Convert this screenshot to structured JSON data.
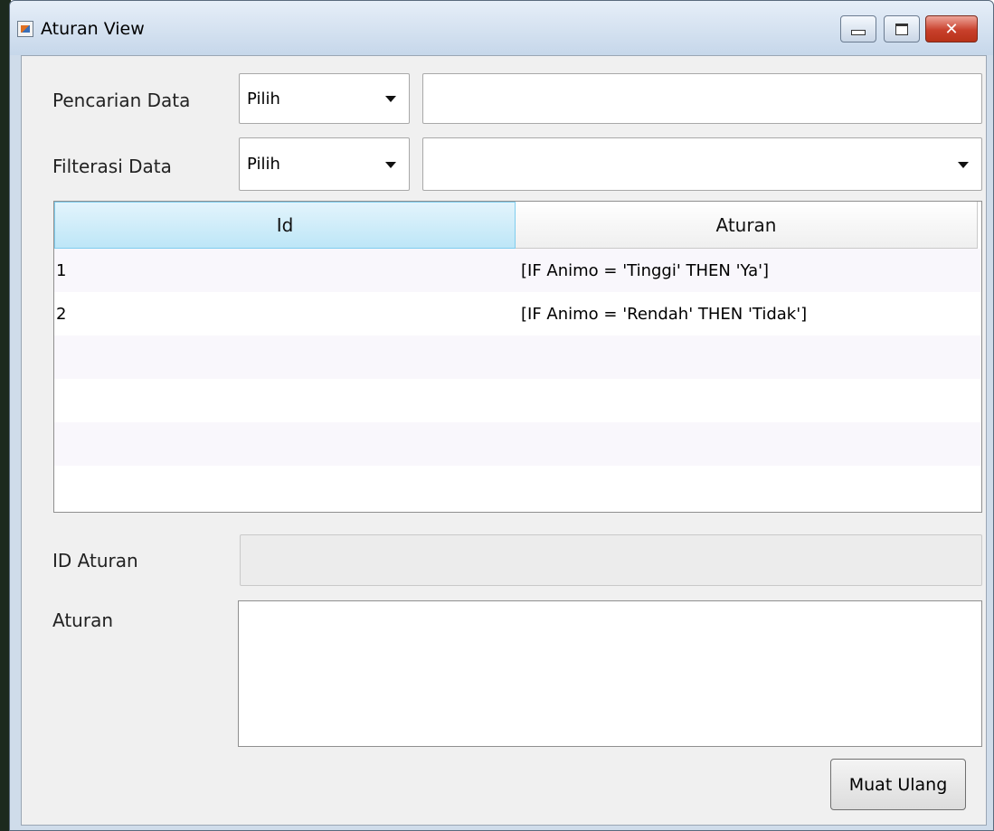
{
  "window": {
    "title": "Aturan View",
    "close_glyph": "✕"
  },
  "search": {
    "label": "Pencarian Data",
    "selected": "Pilih",
    "text_value": ""
  },
  "filter": {
    "label": "Filterasi Data",
    "selected": "Pilih",
    "value_selected": ""
  },
  "table": {
    "columns": [
      "Id",
      "Aturan"
    ],
    "rows": [
      {
        "id": "1",
        "aturan": "[IF Animo = 'Tinggi' THEN 'Ya']"
      },
      {
        "id": "2",
        "aturan": "[IF Animo = 'Rendah' THEN 'Tidak']"
      }
    ]
  },
  "form": {
    "id_label": "ID Aturan",
    "id_value": "",
    "aturan_label": "Aturan",
    "aturan_value": ""
  },
  "actions": {
    "reload_label": "Muat Ulang"
  },
  "icons": {
    "app": "java-app-icon",
    "minimize": "minimize-icon",
    "maximize": "maximize-icon",
    "close": "close-icon",
    "dropdown": "caret-down-icon"
  },
  "colors": {
    "header_selected": "#bde6f7",
    "close_button": "#c8402c",
    "row_alt": "#f9f7fc"
  }
}
